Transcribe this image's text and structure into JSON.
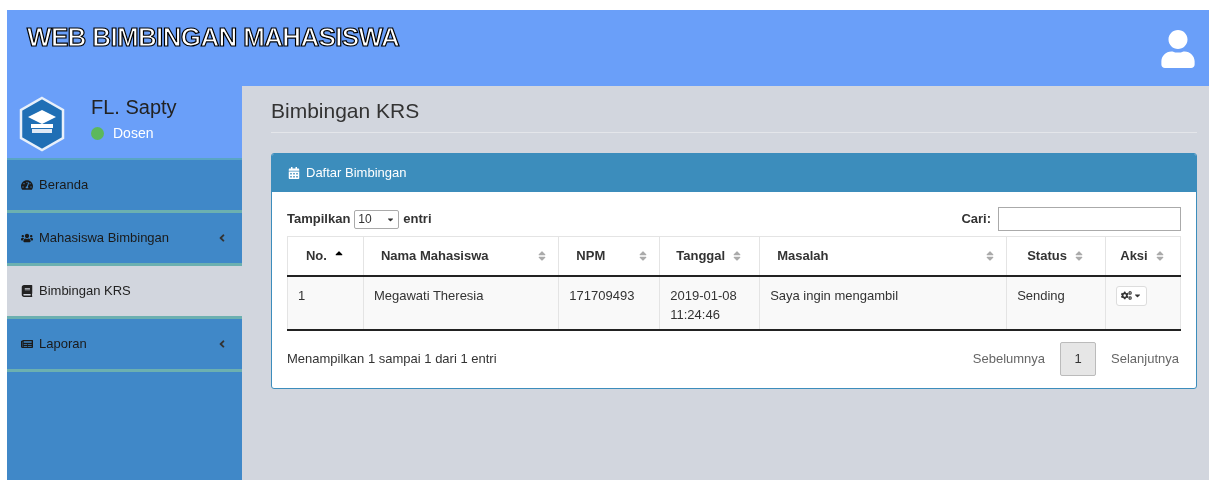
{
  "header": {
    "title": "WEB BIMBINGAN MAHASISWA"
  },
  "user": {
    "name": "FL. Sapty",
    "status": "Dosen",
    "online": true
  },
  "sidebar": {
    "items": [
      {
        "label": "Beranda",
        "selected": false,
        "has_submenu": false
      },
      {
        "label": "Mahasiswa Bimbingan",
        "selected": false,
        "has_submenu": true
      },
      {
        "label": "Bimbingan KRS",
        "selected": true,
        "has_submenu": false
      },
      {
        "label": "Laporan",
        "selected": false,
        "has_submenu": true
      }
    ]
  },
  "page": {
    "title": "Bimbingan KRS"
  },
  "panel": {
    "title": "Daftar Bimbingan",
    "length_label_before": "Tampilkan",
    "length_value": "10",
    "length_label_after": "entri",
    "search_label": "Cari:",
    "table": {
      "columns": [
        {
          "label": "No.",
          "sorted": true
        },
        {
          "label": "Nama Mahasiswa",
          "sorted": false
        },
        {
          "label": "NPM",
          "sorted": false
        },
        {
          "label": "Tanggal",
          "sorted": false
        },
        {
          "label": "Masalah",
          "sorted": false
        },
        {
          "label": "Status",
          "sorted": false
        },
        {
          "label": "Aksi",
          "sorted": false
        }
      ],
      "rows": [
        {
          "cells": [
            "1",
            "Megawati Theresia",
            "171709493",
            "2019-01-08 11:24:46",
            "Saya ingin mengambil",
            "Sending"
          ]
        }
      ]
    },
    "info": "Menampilkan 1 sampai 1 dari 1 entri",
    "pagination": {
      "previous": "Sebelumnya",
      "pages": [
        {
          "label": "1",
          "selected": true
        }
      ],
      "next": "Selanjutnya"
    }
  }
}
